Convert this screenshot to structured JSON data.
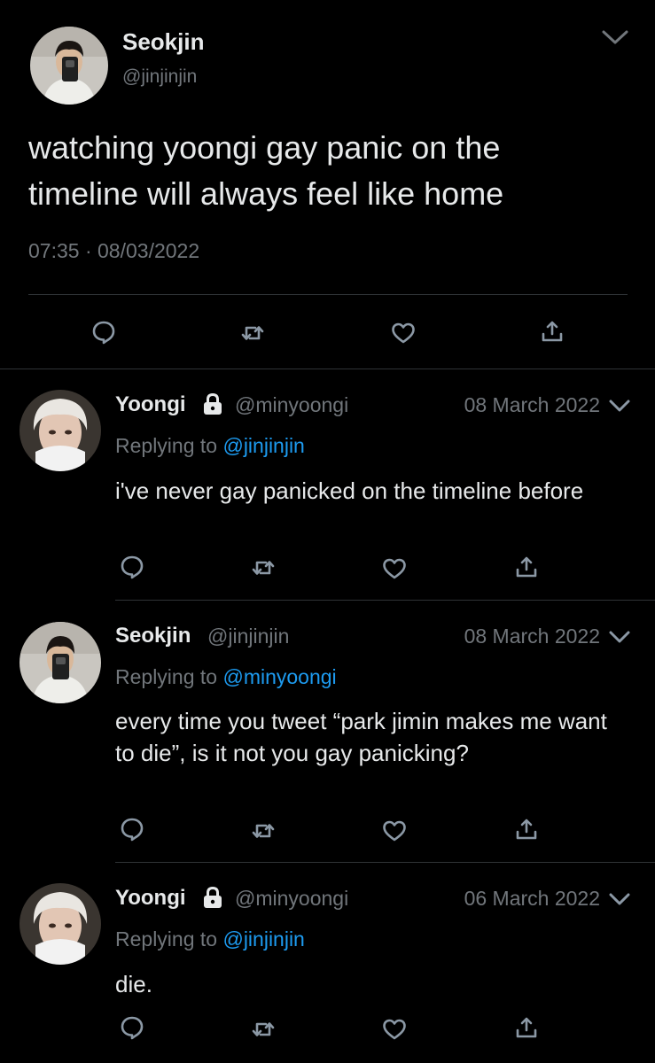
{
  "main_tweet": {
    "author_name": "Seokjin",
    "author_handle": "@jinjinjin",
    "text": "watching yoongi gay panic on the timeline will always feel like home",
    "time": "07:35",
    "separator": "·",
    "date": "08/03/2022"
  },
  "replies": [
    {
      "author_name": "Yoongi",
      "locked": true,
      "author_handle": "@minyoongi",
      "date": "08 March 2022",
      "replying_prefix": "Replying to ",
      "replying_to": "@jinjinjin",
      "text": "i've never gay panicked on the timeline before"
    },
    {
      "author_name": "Seokjin",
      "locked": false,
      "author_handle": "@jinjinjin",
      "date": "08 March 2022",
      "replying_prefix": "Replying to ",
      "replying_to": "@minyoongi",
      "text": "every time you tweet “park jimin makes me want to die”, is it not you gay panicking?"
    },
    {
      "author_name": "Yoongi",
      "locked": true,
      "author_handle": "@minyoongi",
      "date": "06 March 2022",
      "replying_prefix": "Replying to ",
      "replying_to": "@jinjinjin",
      "text": "die."
    }
  ],
  "icons": {
    "reply": "reply-icon",
    "retweet": "retweet-icon",
    "like": "heart-icon",
    "share": "share-icon",
    "more": "chevron-down-icon",
    "protected": "lock-icon"
  },
  "colors": {
    "background": "#000000",
    "text": "#e7e9ea",
    "muted": "#71767b",
    "link": "#1d9bf0",
    "divider": "#2f3336"
  }
}
